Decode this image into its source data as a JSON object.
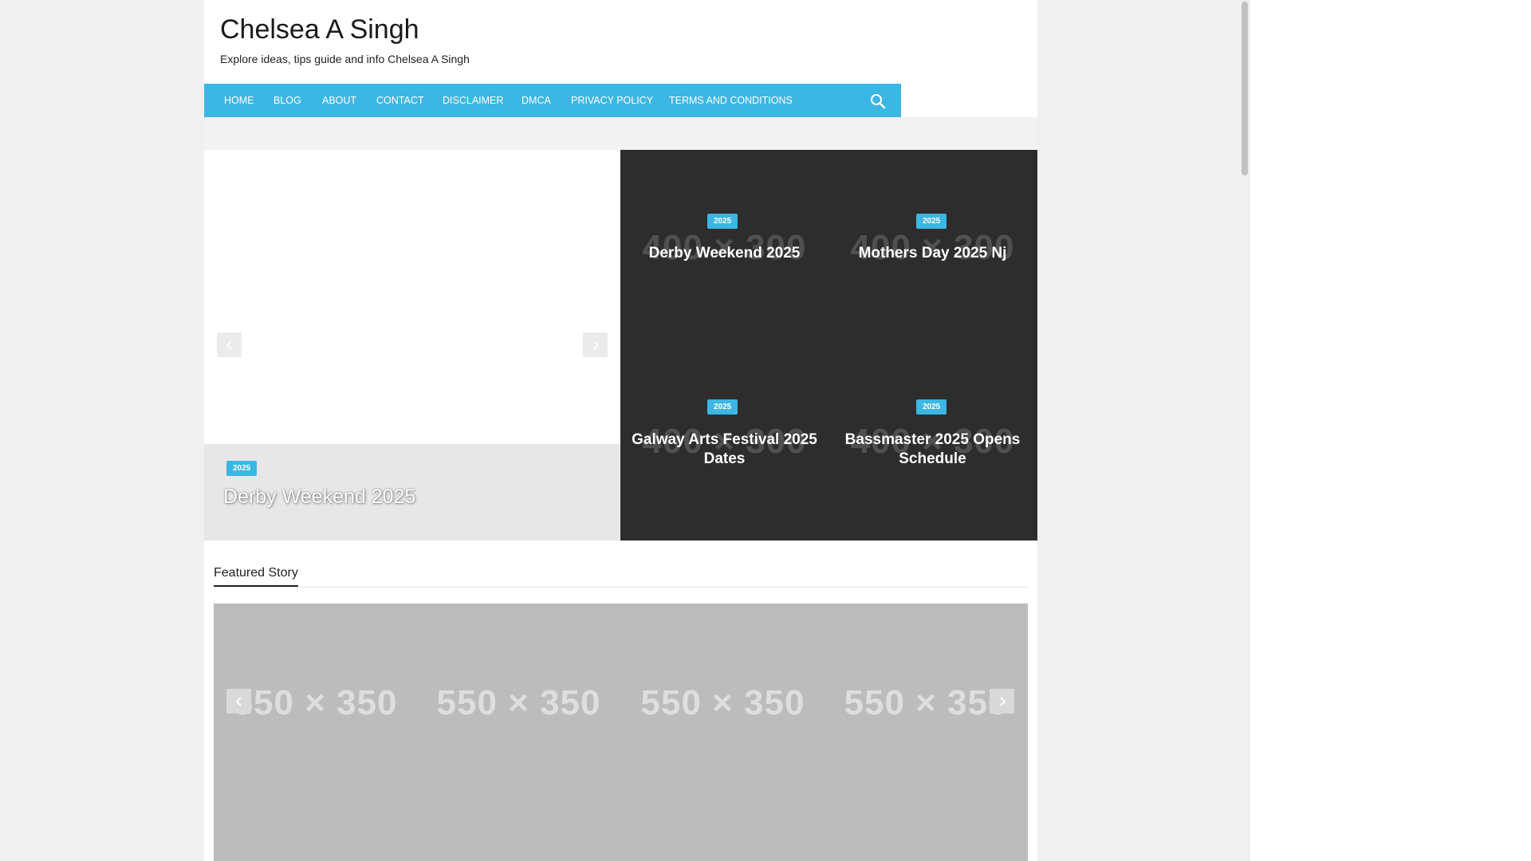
{
  "site": {
    "title": "Chelsea A Singh",
    "description": "Explore ideas, tips guide and info Chelsea A Singh"
  },
  "nav": {
    "items": [
      "HOME",
      "BLOG",
      "ABOUT",
      "CONTACT",
      "DISCLAIMER",
      "DMCA",
      "PRIVACY POLICY",
      "TERMS AND CONDITIONS"
    ],
    "search_icon": "search-icon"
  },
  "slider": {
    "badge": "2025",
    "title": "Derby Weekend 2025",
    "prev_icon": "chevron-left-icon",
    "next_icon": "chevron-right-icon"
  },
  "grid_posts": [
    {
      "badge": "2025",
      "title": "Derby Weekend 2025",
      "placeholder": "400 × 300"
    },
    {
      "badge": "2025",
      "title": "Mothers Day 2025 Nj",
      "placeholder": "400 × 300"
    },
    {
      "badge": "2025",
      "title": "Galway Arts Festival 2025 Dates",
      "placeholder": "400 × 300"
    },
    {
      "badge": "2025",
      "title": "Bassmaster 2025 Opens Schedule",
      "placeholder": "400 × 300"
    }
  ],
  "featured": {
    "heading": "Featured Story",
    "placeholders": [
      "550 × 350",
      "550 × 350",
      "550 × 350",
      "550 × 350"
    ]
  },
  "colors": {
    "accent": "#3cb6e3",
    "dark_panel": "#2d2d2d",
    "page_bg": "#f0f0f0"
  }
}
